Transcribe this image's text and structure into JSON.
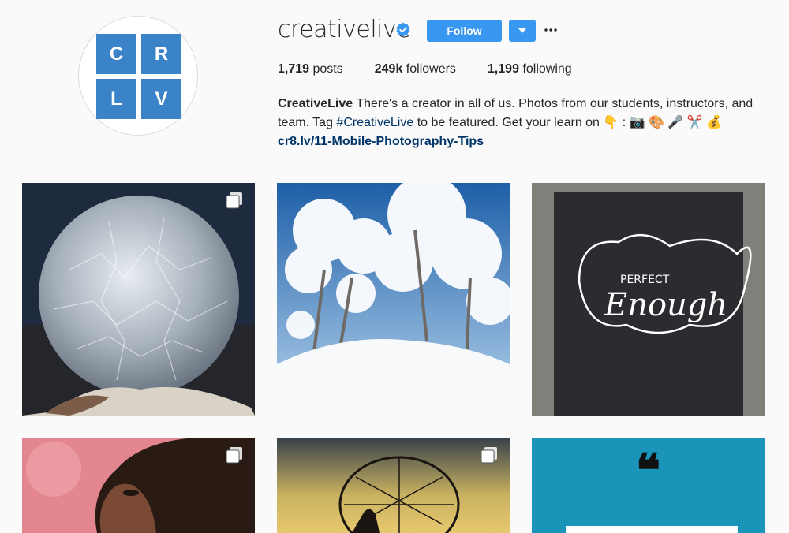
{
  "profile": {
    "username": "creativelive",
    "follow_label": "Follow",
    "logo_letters": [
      "C",
      "R",
      "L",
      "V"
    ],
    "stats": {
      "posts_count": "1,719",
      "posts_label": "posts",
      "followers_count": "249k",
      "followers_label": "followers",
      "following_count": "1,199",
      "following_label": "following"
    },
    "bio": {
      "name": "CreativeLive",
      "text_1": " There's a creator in all of us. Photos from our students, instructors, and team. Tag ",
      "hashtag": "#CreativeLive",
      "text_2": " to be featured. Get your learn on 👇 : 📷 🎨 🎤 ✂️ 💰",
      "link": "cr8.lv/11-Mobile-Photography-Tips"
    }
  },
  "posts": [
    {
      "subject": "frozen-bubble",
      "multi": true
    },
    {
      "subject": "snowy-trees",
      "multi": false
    },
    {
      "subject": "perfect-enough-sign",
      "multi": false,
      "sign_line_1": "PERFECT",
      "sign_line_2": "Enough"
    },
    {
      "subject": "portrait",
      "multi": true
    },
    {
      "subject": "fisherman-net",
      "multi": true
    },
    {
      "subject": "quote-card",
      "multi": false,
      "quote_mark": "❝"
    }
  ],
  "colors": {
    "brand_blue": "#3b83c8",
    "follow_blue": "#3897f0",
    "link_blue": "#003569",
    "quote_teal": "#1a94b8"
  }
}
